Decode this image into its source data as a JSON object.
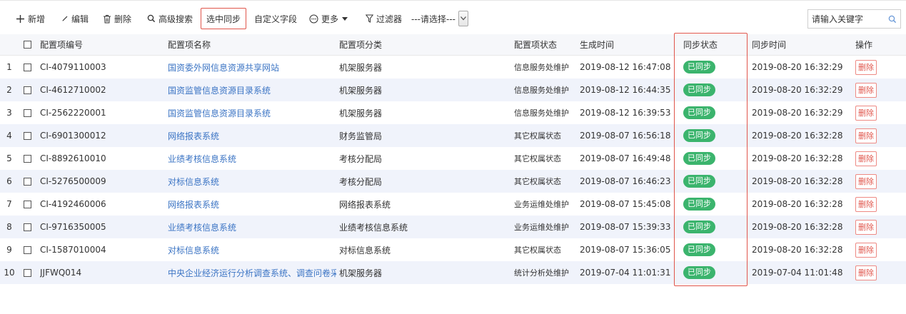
{
  "toolbar": {
    "add": "新增",
    "edit": "编辑",
    "delete": "删除",
    "advanced_search": "高级搜索",
    "sync_selected": "选中同步",
    "custom_fields": "自定义字段",
    "more": "更多",
    "filter": "过滤器",
    "select_value": "---请选择---",
    "search_placeholder": "请输入关键字"
  },
  "colors": {
    "accent_red": "#e0554b",
    "link_blue": "#3b74c4",
    "badge_green": "#3bb46d",
    "stripe": "#f0f3fb"
  },
  "table": {
    "columns": [
      "配置项编号",
      "配置项名称",
      "配置项分类",
      "配置项状态",
      "生成时间",
      "同步状态",
      "同步时间",
      "操作"
    ],
    "rows": [
      {
        "index": "1",
        "code": "CI-4079110003",
        "name": "国资委外网信息资源共享网站",
        "category": "机架服务器",
        "status": "信息服务处维护",
        "generated": "2019-08-12 16:47:08",
        "sync_status": "已同步",
        "sync_time": "2019-08-20 16:32:29",
        "op": "删除"
      },
      {
        "index": "2",
        "code": "CI-4612710002",
        "name": "国资监管信息资源目录系统",
        "category": "机架服务器",
        "status": "信息服务处维护",
        "generated": "2019-08-12 16:44:35",
        "sync_status": "已同步",
        "sync_time": "2019-08-20 16:32:29",
        "op": "删除"
      },
      {
        "index": "3",
        "code": "CI-2562220001",
        "name": "国资监管信息资源目录系统",
        "category": "机架服务器",
        "status": "信息服务处维护",
        "generated": "2019-08-12 16:39:53",
        "sync_status": "已同步",
        "sync_time": "2019-08-20 16:32:29",
        "op": "删除"
      },
      {
        "index": "4",
        "code": "CI-6901300012",
        "name": "网络报表系统",
        "category": "财务监管局",
        "status": "其它权属状态",
        "generated": "2019-08-07 16:56:18",
        "sync_status": "已同步",
        "sync_time": "2019-08-20 16:32:28",
        "op": "删除"
      },
      {
        "index": "5",
        "code": "CI-8892610010",
        "name": "业绩考核信息系统",
        "category": "考核分配局",
        "status": "其它权属状态",
        "generated": "2019-08-07 16:49:48",
        "sync_status": "已同步",
        "sync_time": "2019-08-20 16:32:28",
        "op": "删除"
      },
      {
        "index": "6",
        "code": "CI-5276500009",
        "name": "对标信息系统",
        "category": "考核分配局",
        "status": "其它权属状态",
        "generated": "2019-08-07 16:46:23",
        "sync_status": "已同步",
        "sync_time": "2019-08-20 16:32:28",
        "op": "删除"
      },
      {
        "index": "7",
        "code": "CI-4192460006",
        "name": "网络报表系统",
        "category": "网络报表系统",
        "status": "业务运维处维护",
        "generated": "2019-08-07 15:45:08",
        "sync_status": "已同步",
        "sync_time": "2019-08-20 16:32:28",
        "op": "删除"
      },
      {
        "index": "8",
        "code": "CI-9716350005",
        "name": "业绩考核信息系统",
        "category": "业绩考核信息系统",
        "status": "业务运维处维护",
        "generated": "2019-08-07 15:39:33",
        "sync_status": "已同步",
        "sync_time": "2019-08-20 16:32:28",
        "op": "删除"
      },
      {
        "index": "9",
        "code": "CI-1587010004",
        "name": "对标信息系统",
        "category": "对标信息系统",
        "status": "其它权属状态",
        "generated": "2019-08-07 15:36:05",
        "sync_status": "已同步",
        "sync_time": "2019-08-20 16:32:28",
        "op": "删除"
      },
      {
        "index": "10",
        "code": "JJFWQ014",
        "name": "中央企业经济运行分析调查系统、调查问卷采集",
        "category": "机架服务器",
        "status": "统计分析处维护",
        "generated": "2019-07-04 11:01:31",
        "sync_status": "已同步",
        "sync_time": "2019-07-04 11:01:48",
        "op": "删除"
      }
    ]
  }
}
